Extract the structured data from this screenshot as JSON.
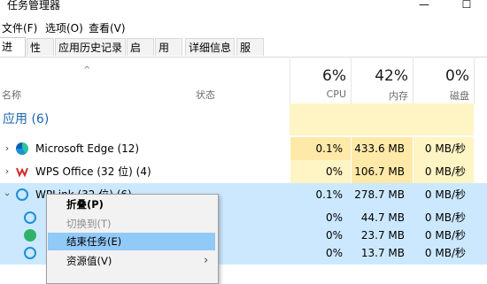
{
  "window": {
    "title": "任务管理器",
    "minimize_glyph": "—",
    "maximize_glyph": "☐"
  },
  "menu": [
    "文件(F)",
    "选项(O)",
    "查看(V)"
  ],
  "tabs": [
    "进程",
    "性能",
    "应用历史记录",
    "启动",
    "用户",
    "详细信息",
    "服务"
  ],
  "header": {
    "name_label": "名称",
    "status_label": "状态",
    "cpu_pct": "6%",
    "cpu_label": "CPU",
    "mem_pct": "42%",
    "mem_label": "内存",
    "disk_pct": "0%",
    "disk_label": "磁盘"
  },
  "group_title": "应用 (6)",
  "rows": [
    {
      "name": "Microsoft Edge (12)",
      "cpu": "0.1%",
      "mem": "433.6 MB",
      "disk": "0 MB/秒"
    },
    {
      "name": "WPS Office (32 位) (4)",
      "cpu": "0%",
      "mem": "106.7 MB",
      "disk": "0 MB/秒"
    },
    {
      "name": "WPLink (32 位) (6)",
      "cpu": "0.1%",
      "mem": "278.7 MB",
      "disk": "0 MB/秒"
    },
    {
      "name": "",
      "cpu": "0%",
      "mem": "44.7 MB",
      "disk": "0 MB/秒"
    },
    {
      "name": "",
      "cpu": "0%",
      "mem": "23.7 MB",
      "disk": "0 MB/秒"
    },
    {
      "name": "",
      "cpu": "0%",
      "mem": "13.7 MB",
      "disk": "0 MB/秒"
    }
  ],
  "context_menu": {
    "items": [
      {
        "label": "折叠(P)"
      },
      {
        "label": "切换到(T)"
      },
      {
        "label": "结束任务(E)"
      },
      {
        "label": "资源值(V)"
      }
    ],
    "submenu_arrow": "›"
  },
  "colors": {
    "accent": "#1a65b2",
    "cpu_light": "#fff4c4",
    "cpu_med": "#ffe9a8",
    "selected_row": "#cce8ff",
    "menu_hover": "#91c9f7"
  }
}
